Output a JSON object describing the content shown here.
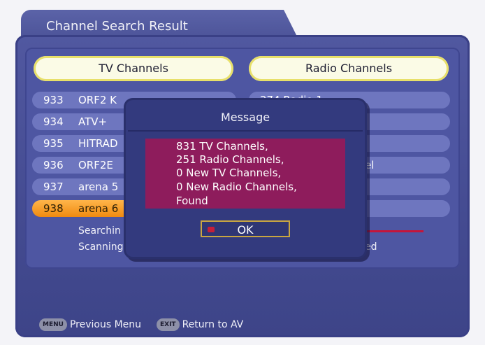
{
  "screen": {
    "title": "Channel Search Result"
  },
  "columns": {
    "tv_header": "TV Channels",
    "radio_header": "Radio Channels"
  },
  "tv_list": [
    {
      "num": "933",
      "name": "ORF2 K"
    },
    {
      "num": "934",
      "name": "ATV+"
    },
    {
      "num": "935",
      "name": "HITRAD"
    },
    {
      "num": "936",
      "name": "ORF2E"
    },
    {
      "num": "937",
      "name": "arena 5"
    },
    {
      "num": "938",
      "name": "arena 6"
    }
  ],
  "radio_list": [
    {
      "text": "274  Radio 1"
    },
    {
      "text": ""
    },
    {
      "text": ""
    },
    {
      "text": "el"
    },
    {
      "text": ""
    },
    {
      "text": ""
    }
  ],
  "status": {
    "searching": "Searchin",
    "scanning": "Scanning",
    "scanning_right": "ed"
  },
  "dialog": {
    "title": "Message",
    "lines": [
      "831 TV Channels,",
      "251 Radio Channels,",
      "0 New TV Channels,",
      "0 New Radio Channels,",
      "Found"
    ],
    "ok_label": "OK"
  },
  "footer": {
    "menu_key": "MENU",
    "menu_label": "Previous Menu",
    "exit_key": "EXIT",
    "exit_label": "Return to AV"
  },
  "colors": {
    "panel": "#4a5196",
    "highlight": "#f08a10",
    "message_bg": "#8e1c5c"
  }
}
